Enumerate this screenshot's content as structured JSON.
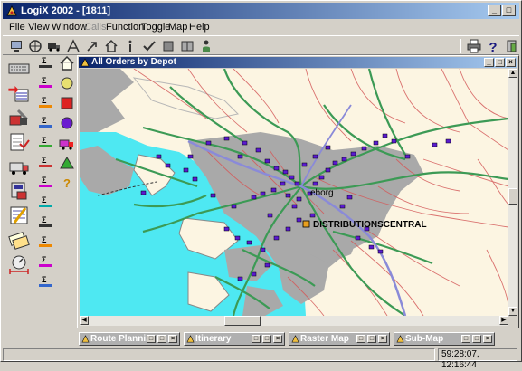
{
  "app": {
    "title": "LogiX 2002 - [1811]"
  },
  "window_controls": {
    "minimize": "_",
    "maximize": "□",
    "close": "×"
  },
  "menu": {
    "items": [
      "File",
      "View",
      "Window",
      "Calls",
      "Function",
      "Toggle",
      "Map",
      "Help"
    ],
    "disabled": [
      "Calls"
    ]
  },
  "toolbar": {
    "left_icons": [
      "monitor-icon",
      "globe-icon",
      "truck-icon",
      "route-icon",
      "arrow-icon",
      "home-icon",
      "info-icon",
      "check-icon",
      "square-icon",
      "split-icon",
      "person-icon"
    ],
    "right_icons": [
      "printer-icon",
      "help-icon",
      "exit-icon"
    ]
  },
  "left_toolbar": {
    "col1": [
      "keyboard-icon",
      "data-import-icon",
      "tools-icon",
      "checklist-icon",
      "vehicle-icon",
      "dispatch-icon",
      "schedule-icon",
      "tickets-icon",
      "measure-icon"
    ],
    "col2": [
      "sigma-icon",
      "sigma-icon",
      "sigma-icon",
      "sigma-icon",
      "sigma-icon",
      "sigma-icon",
      "sigma-icon",
      "sigma-icon",
      "sigma-icon",
      "sigma-icon",
      "sigma-icon",
      "sigma-icon"
    ],
    "col3": [
      "home-icon",
      "circle-icon",
      "red-square-icon",
      "purple-circle-icon",
      "truck-icon",
      "triangle-icon",
      "question-icon"
    ]
  },
  "map_window": {
    "title": "All Orders by Depot",
    "labels": {
      "city": "eborg",
      "depot": "DISTRIBUTIONSCENTRAL"
    }
  },
  "colors": {
    "title_active": "#0a246a",
    "title_gradient_end": "#a6caf0",
    "water": "#4ee8f2",
    "land": "#fcf5e2",
    "urban": "#a9a9a9",
    "major_road": "#3c9a55",
    "street": "#d45a5a",
    "highway": "#8a8ad8",
    "order_marker": "#5a1ad0",
    "depot_marker": "#e8a020"
  },
  "minimized_windows": [
    {
      "title": "Route Planni..."
    },
    {
      "title": "Itinerary"
    },
    {
      "title": "Raster Map"
    },
    {
      "title": "Sub-Map"
    }
  ],
  "status": {
    "timestamp": "59:28:07, 12:16:44"
  }
}
